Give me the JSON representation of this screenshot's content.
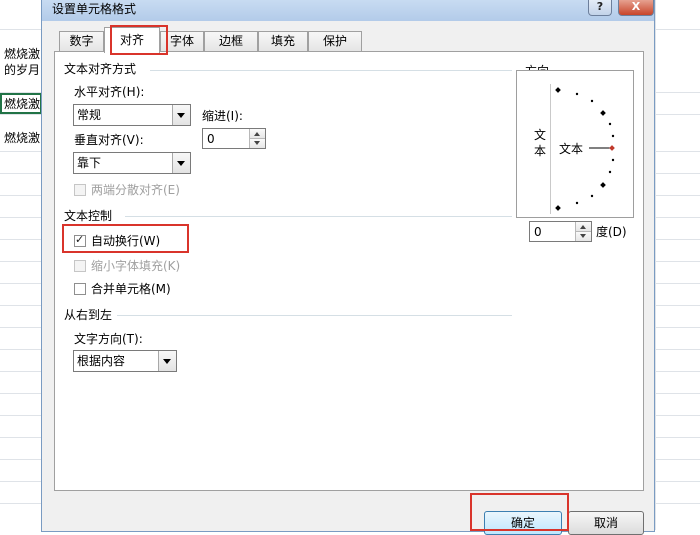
{
  "sheet": {
    "cells": [
      "燃烧激",
      "的岁月",
      "燃烧激",
      "燃烧激"
    ]
  },
  "dialog": {
    "title": "设置单元格格式",
    "help": "?",
    "close": "X"
  },
  "tabs": [
    "数字",
    "对齐",
    "字体",
    "边框",
    "填充",
    "保护"
  ],
  "active_tab": "对齐",
  "alignment": {
    "section_title": "文本对齐方式",
    "horizontal_label": "水平对齐(H):",
    "horizontal_value": "常规",
    "indent_label": "缩进(I):",
    "indent_value": "0",
    "vertical_label": "垂直对齐(V):",
    "vertical_value": "靠下",
    "justify_distributed": "两端分散对齐(E)"
  },
  "text_control": {
    "section_title": "文本控制",
    "wrap_text": "自动换行(W)",
    "wrap_text_checked": true,
    "shrink_to_fit": "缩小字体填充(K)",
    "merge_cells": "合并单元格(M)"
  },
  "rtl": {
    "section_title": "从右到左",
    "direction_label": "文字方向(T):",
    "direction_value": "根据内容"
  },
  "orientation": {
    "section_title": "方向",
    "vertical_text": [
      "文",
      "本"
    ],
    "text_label": "文本",
    "degrees_value": "0",
    "degrees_label": "度(D)"
  },
  "buttons": {
    "ok": "确定",
    "cancel": "取消"
  },
  "colors": {
    "highlight_red": "#d9342b",
    "title_bar": "#b3cbe9"
  }
}
